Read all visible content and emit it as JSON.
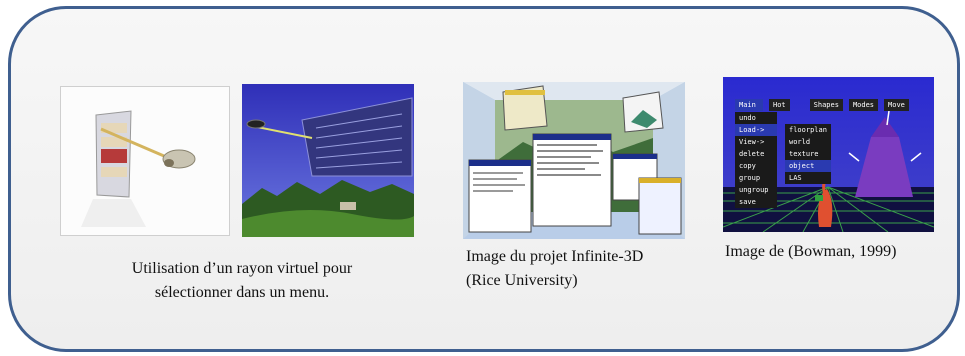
{
  "captions": {
    "ray_menu": {
      "line1": "Utilisation d’un rayon virtuel pour",
      "line2": "sélectionner dans un menu."
    },
    "infinite3d": {
      "line1": "Image du projet Infinite-3D",
      "line2": "(Rice University)"
    },
    "bowman": {
      "line1": "Image de (Bowman, 1999)"
    }
  },
  "bowman_menu": {
    "top_bar": [
      "Main",
      "Hot",
      "Shapes",
      "Modes",
      "Move"
    ],
    "left_column": [
      "undo",
      "Load->",
      "View->",
      "delete",
      "copy",
      "group",
      "ungroup",
      "save"
    ],
    "right_column": [
      "floorplan",
      "world",
      "texture",
      "object",
      "LAS"
    ]
  },
  "colors": {
    "frame_border": "#3f5f8f",
    "sky_blue": "#4a4fd0",
    "grid_green": "#3aa04a"
  }
}
